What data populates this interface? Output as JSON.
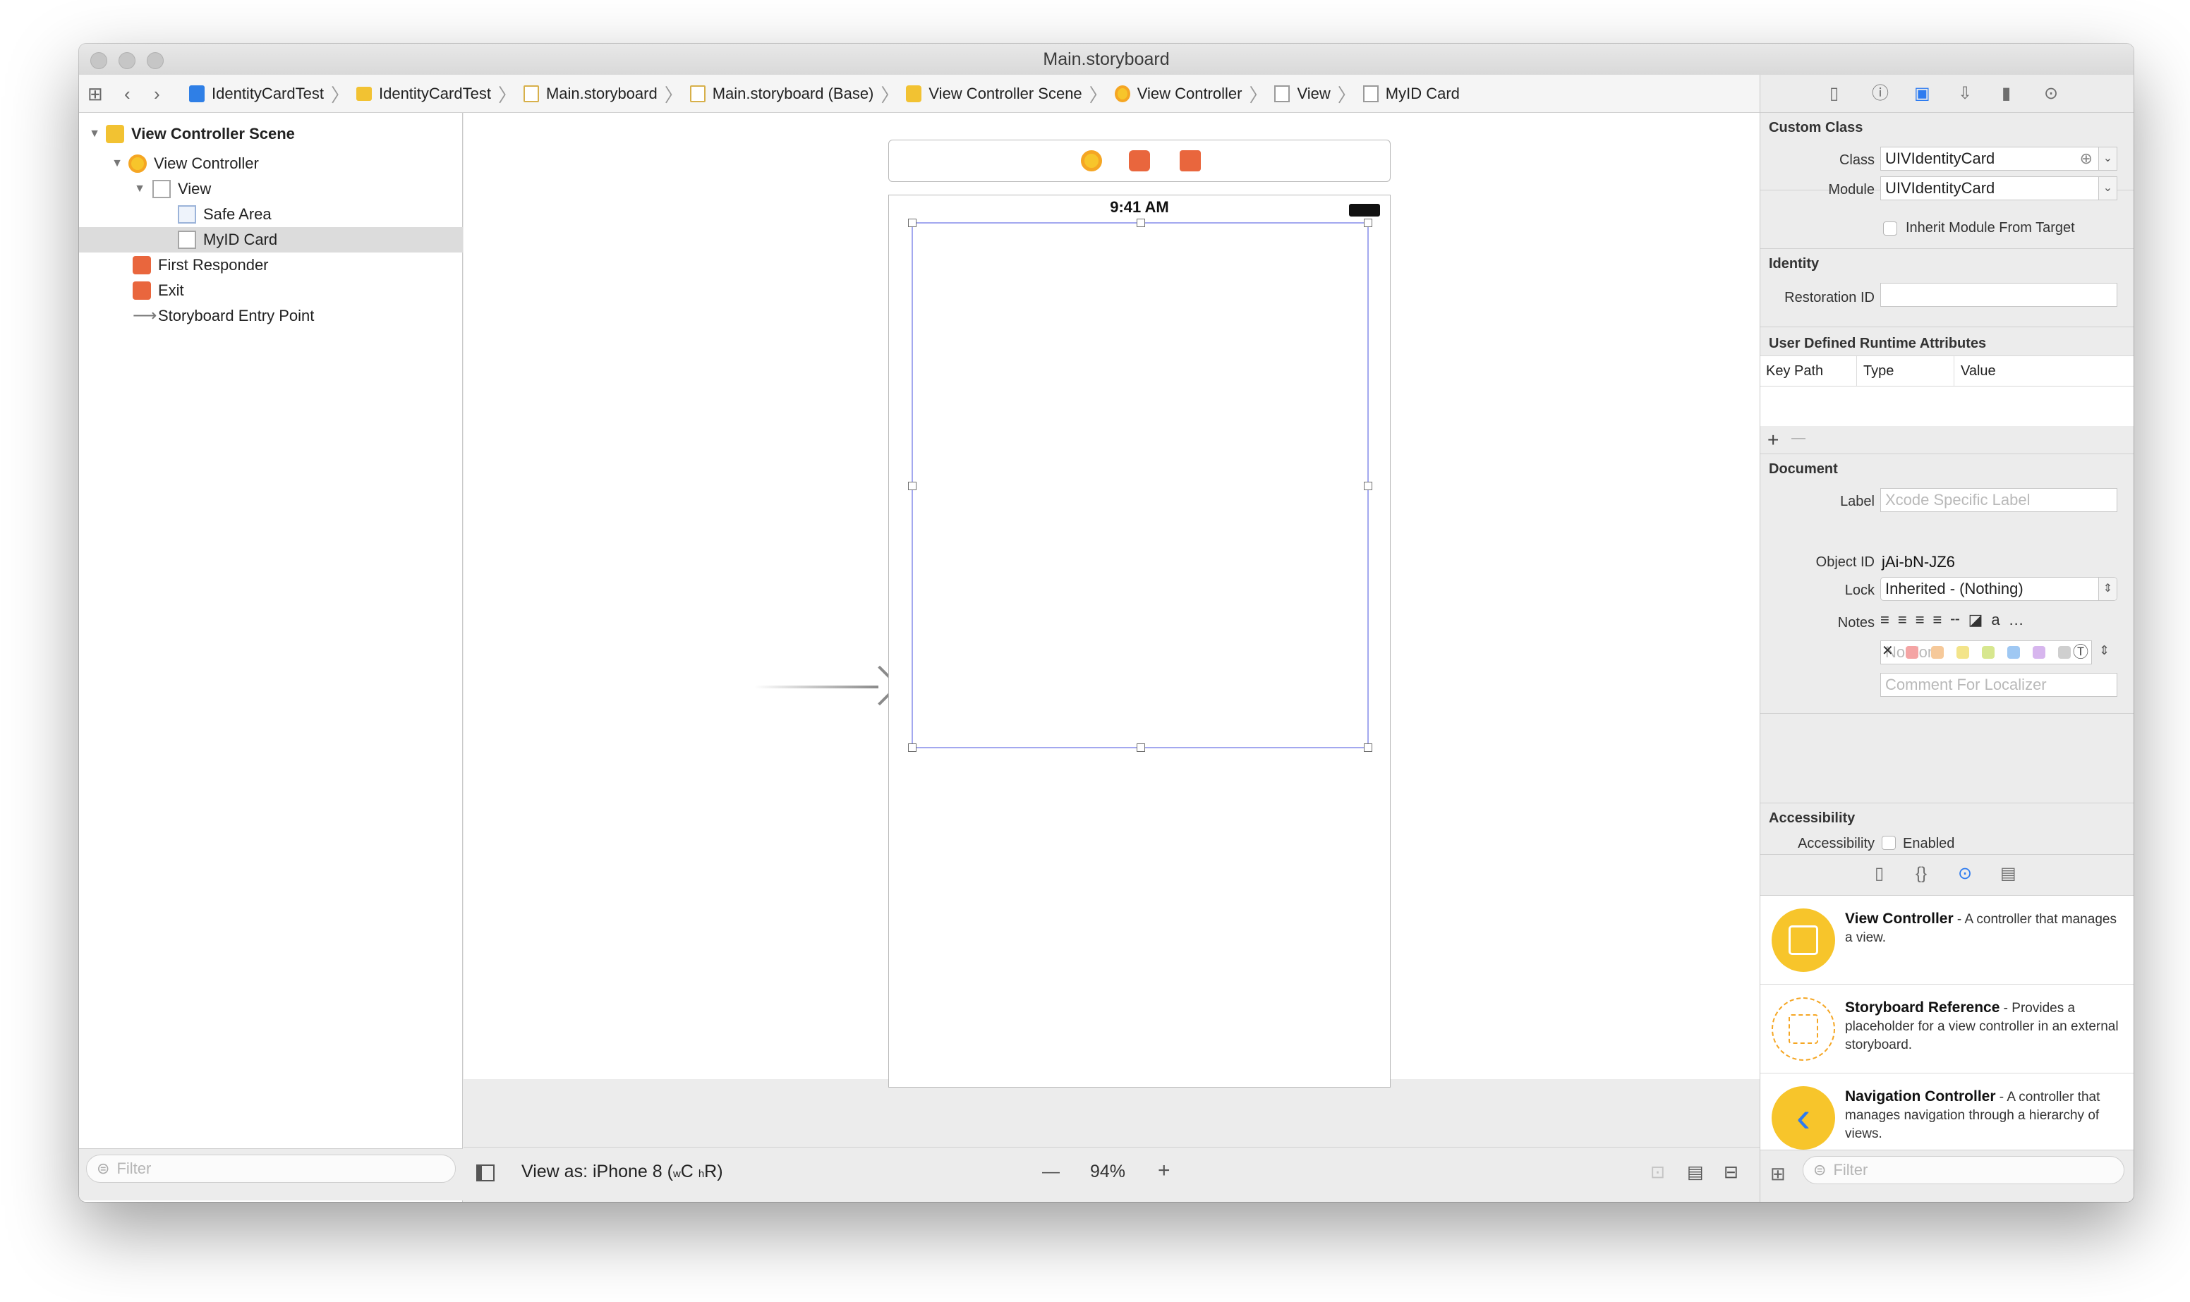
{
  "window": {
    "title": "Main.storyboard"
  },
  "jumpbar": {
    "crumbs": [
      {
        "label": "IdentityCardTest",
        "icon": "project-icon"
      },
      {
        "label": "IdentityCardTest",
        "icon": "folder-icon"
      },
      {
        "label": "Main.storyboard",
        "icon": "storyboard-file-icon"
      },
      {
        "label": "Main.storyboard (Base)",
        "icon": "storyboard-file-icon"
      },
      {
        "label": "View Controller Scene",
        "icon": "scene-icon"
      },
      {
        "label": "View Controller",
        "icon": "view-controller-icon"
      },
      {
        "label": "View",
        "icon": "view-icon"
      },
      {
        "label": "MyID Card",
        "icon": "view-icon"
      }
    ]
  },
  "navigator": {
    "items": [
      {
        "label": "View Controller Scene",
        "icon": "scene-icon",
        "disclosure": "expanded"
      },
      {
        "label": "View Controller",
        "icon": "view-controller-icon",
        "disclosure": "expanded"
      },
      {
        "label": "View",
        "icon": "view-icon",
        "disclosure": "expanded"
      },
      {
        "label": "Safe Area",
        "icon": "safe-area-icon"
      },
      {
        "label": "MyID Card",
        "icon": "view-icon",
        "selected": true
      },
      {
        "label": "First Responder",
        "icon": "first-responder-icon"
      },
      {
        "label": "Exit",
        "icon": "exit-icon"
      },
      {
        "label": "Storyboard Entry Point",
        "icon": "entry-arrow-icon"
      }
    ],
    "filter_placeholder": "Filter"
  },
  "canvas": {
    "status_time": "9:41 AM",
    "view_as_label": "View as: iPhone 8 (",
    "size_class_w": "w",
    "size_class_w_value": "C",
    "size_class_h": "h",
    "size_class_h_value": "R)",
    "zoom": "94%",
    "zoom_out": "—",
    "zoom_in": "+"
  },
  "inspector": {
    "custom_class": {
      "title": "Custom Class",
      "class_label": "Class",
      "class_value": "UIVIdentityCard",
      "module_label": "Module",
      "module_value": "UIVIdentityCard",
      "inherit_label": "Inherit Module From Target"
    },
    "identity": {
      "title": "Identity",
      "restoration_label": "Restoration ID",
      "restoration_value": ""
    },
    "runtime_attrs": {
      "title": "User Defined Runtime Attributes",
      "columns": [
        "Key Path",
        "Type",
        "Value"
      ],
      "add": "+",
      "remove": "—"
    },
    "document": {
      "title": "Document",
      "label_label": "Label",
      "label_placeholder": "Xcode Specific Label",
      "clear_glyph": "✕",
      "label_colors": [
        "#f4a4a4",
        "#f6c99a",
        "#f3e48a",
        "#d7e78f",
        "#9fc8f3",
        "#d7b6ee",
        "#cfcfcf"
      ],
      "object_id_label": "Object ID",
      "object_id_value": "jAi-bN-JZ6",
      "lock_label": "Lock",
      "lock_value": "Inherited - (Nothing)",
      "notes_label": "Notes",
      "font_placeholder": "No Font",
      "comment_placeholder": "Comment For Localizer"
    },
    "accessibility": {
      "title": "Accessibility",
      "label": "Accessibility",
      "enabled_label": "Enabled"
    }
  },
  "library": {
    "items": [
      {
        "name": "View Controller",
        "desc": " - A controller that manages a view."
      },
      {
        "name": "Storyboard Reference",
        "desc": " - Provides a placeholder for a view controller in an external storyboard."
      },
      {
        "name": "Navigation Controller",
        "desc": " - A controller that manages navigation through a hierarchy of views."
      }
    ],
    "filter_placeholder": "Filter"
  },
  "colors": {
    "accent": "#2d7bf0",
    "selection_outline": "#a3a8ef",
    "library_yellow": "#f7c52b",
    "library_blue": "#2d7bf0"
  }
}
